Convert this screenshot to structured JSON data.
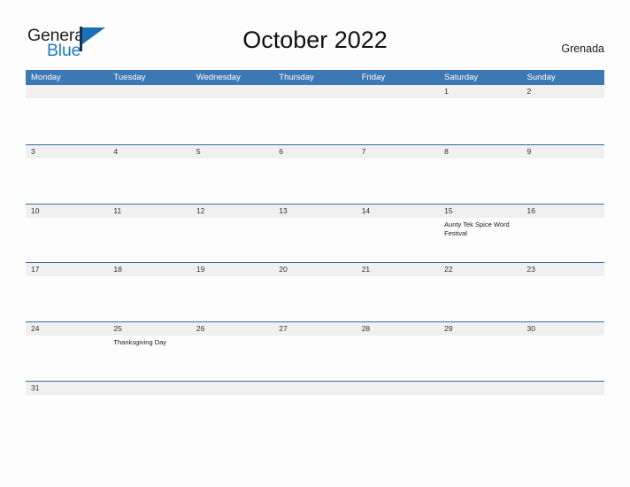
{
  "brand": {
    "name_part1": "General",
    "name_part2": "Blue",
    "flag_icon": "flag-triangle-icon",
    "accent_color": "#1d7cc4"
  },
  "header": {
    "title": "October 2022",
    "country": "Grenada"
  },
  "theme": {
    "header_band_color": "#3b78b4",
    "date_strip_color": "#f0f0f0",
    "row_divider_color": "#2e6da4",
    "page_background": "#fdfdfd",
    "text_color": "#1a1a1a"
  },
  "calendar": {
    "weekdays": [
      "Monday",
      "Tuesday",
      "Wednesday",
      "Thursday",
      "Friday",
      "Saturday",
      "Sunday"
    ],
    "weeks": [
      [
        {
          "date": "",
          "events": []
        },
        {
          "date": "",
          "events": []
        },
        {
          "date": "",
          "events": []
        },
        {
          "date": "",
          "events": []
        },
        {
          "date": "",
          "events": []
        },
        {
          "date": "1",
          "events": []
        },
        {
          "date": "2",
          "events": []
        }
      ],
      [
        {
          "date": "3",
          "events": []
        },
        {
          "date": "4",
          "events": []
        },
        {
          "date": "5",
          "events": []
        },
        {
          "date": "6",
          "events": []
        },
        {
          "date": "7",
          "events": []
        },
        {
          "date": "8",
          "events": []
        },
        {
          "date": "9",
          "events": []
        }
      ],
      [
        {
          "date": "10",
          "events": []
        },
        {
          "date": "11",
          "events": []
        },
        {
          "date": "12",
          "events": []
        },
        {
          "date": "13",
          "events": []
        },
        {
          "date": "14",
          "events": []
        },
        {
          "date": "15",
          "events": [
            "Aunty Tek Spice Word Festival"
          ]
        },
        {
          "date": "16",
          "events": []
        }
      ],
      [
        {
          "date": "17",
          "events": []
        },
        {
          "date": "18",
          "events": []
        },
        {
          "date": "19",
          "events": []
        },
        {
          "date": "20",
          "events": []
        },
        {
          "date": "21",
          "events": []
        },
        {
          "date": "22",
          "events": []
        },
        {
          "date": "23",
          "events": []
        }
      ],
      [
        {
          "date": "24",
          "events": []
        },
        {
          "date": "25",
          "events": [
            "Thanksgiving Day"
          ]
        },
        {
          "date": "26",
          "events": []
        },
        {
          "date": "27",
          "events": []
        },
        {
          "date": "28",
          "events": []
        },
        {
          "date": "29",
          "events": []
        },
        {
          "date": "30",
          "events": []
        }
      ],
      [
        {
          "date": "31",
          "events": []
        },
        {
          "date": "",
          "events": []
        },
        {
          "date": "",
          "events": []
        },
        {
          "date": "",
          "events": []
        },
        {
          "date": "",
          "events": []
        },
        {
          "date": "",
          "events": []
        },
        {
          "date": "",
          "events": []
        }
      ]
    ]
  }
}
